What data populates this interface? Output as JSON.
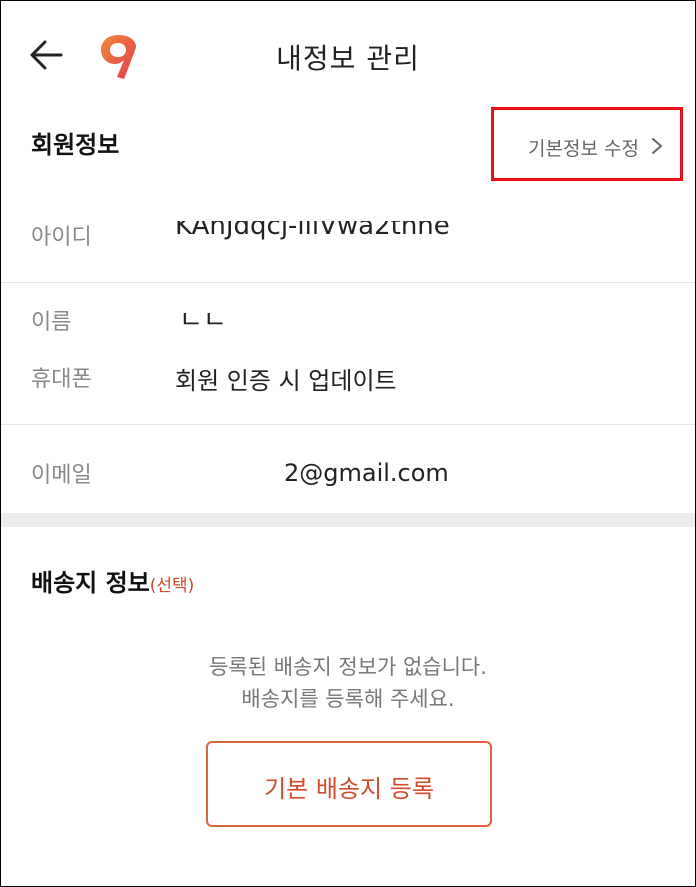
{
  "header": {
    "title": "내정보 관리",
    "back_icon": "arrow-left-icon",
    "logo_icon": "brand-logo-icon",
    "logo_color": "#e8503a"
  },
  "member": {
    "section_title": "회원정보",
    "edit_label": "기본정보 수정",
    "edit_highlight_color": "#e8111a",
    "fields": {
      "id_label": "아이디",
      "id_value": "KAhJdqcj-iiiVwa2thne",
      "name_label": "이름",
      "name_value": "ㄴㄴ",
      "phone_label": "휴대폰",
      "phone_value": "회원 인증 시 업데이트",
      "email_label": "이메일",
      "email_value": "2@gmail.com"
    }
  },
  "shipping": {
    "section_title": "배송지 정보",
    "optional_label": "(선택)",
    "empty_line1": "등록된 배송지 정보가 없습니다.",
    "empty_line2": "배송지를 등록해 주세요.",
    "register_label": "기본 배송지 등록",
    "accent_color": "#d24b2a"
  }
}
